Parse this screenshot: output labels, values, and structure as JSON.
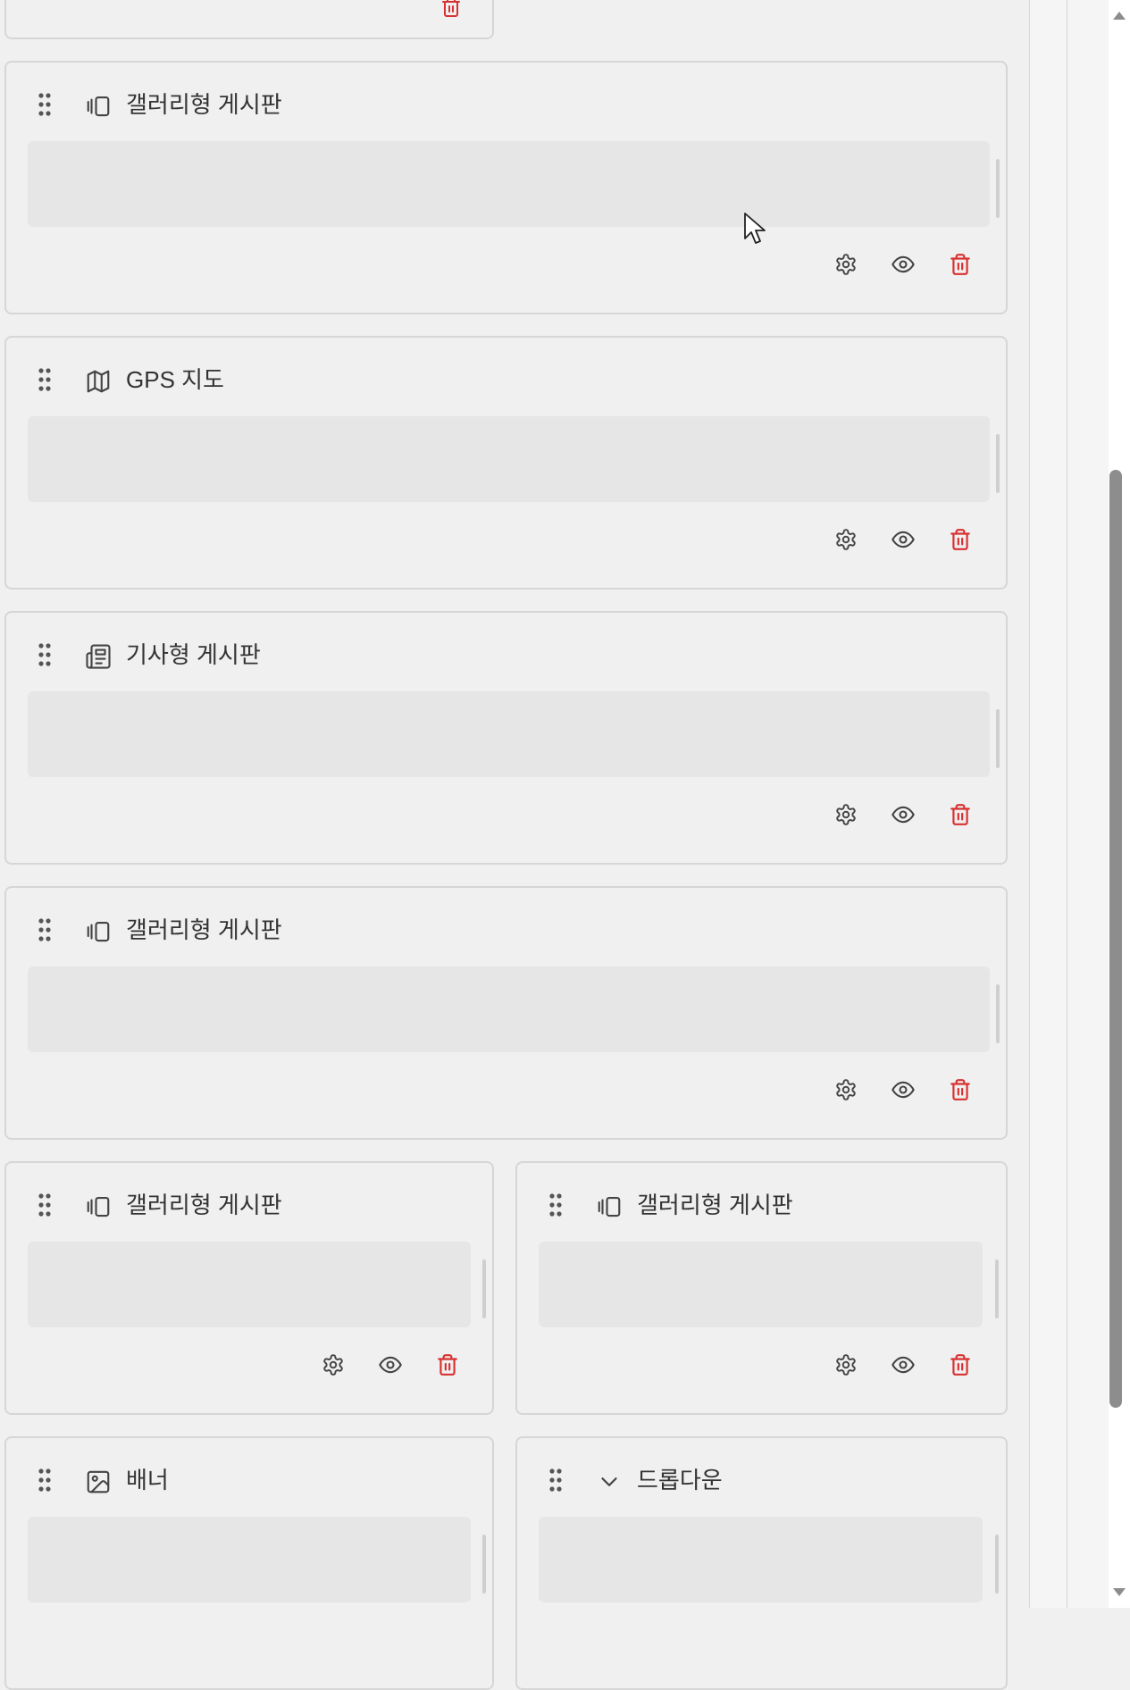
{
  "colors": {
    "icon": "#444444",
    "danger": "#d93131",
    "border": "#d6d6d6",
    "content": "#e6e6e6",
    "background": "#f0f0f0"
  },
  "cards": [
    {
      "id": "gallery-1",
      "title": "갤러리형 게시판",
      "icon": "gallery-icon"
    },
    {
      "id": "gps-map",
      "title": "GPS 지도",
      "icon": "map-icon"
    },
    {
      "id": "article",
      "title": "기사형 게시판",
      "icon": "newspaper-icon"
    },
    {
      "id": "gallery-2",
      "title": "갤러리형 게시판",
      "icon": "gallery-icon"
    },
    {
      "id": "gallery-3",
      "title": "갤러리형 게시판",
      "icon": "gallery-icon"
    },
    {
      "id": "gallery-4",
      "title": "갤러리형 게시판",
      "icon": "gallery-icon"
    },
    {
      "id": "banner",
      "title": "배너",
      "icon": "image-icon"
    },
    {
      "id": "dropdown",
      "title": "드롭다운",
      "icon": "chevron-down-icon"
    }
  ],
  "actions": {
    "settings": "gear-icon",
    "visibility": "eye-icon",
    "delete": "trash-icon"
  }
}
